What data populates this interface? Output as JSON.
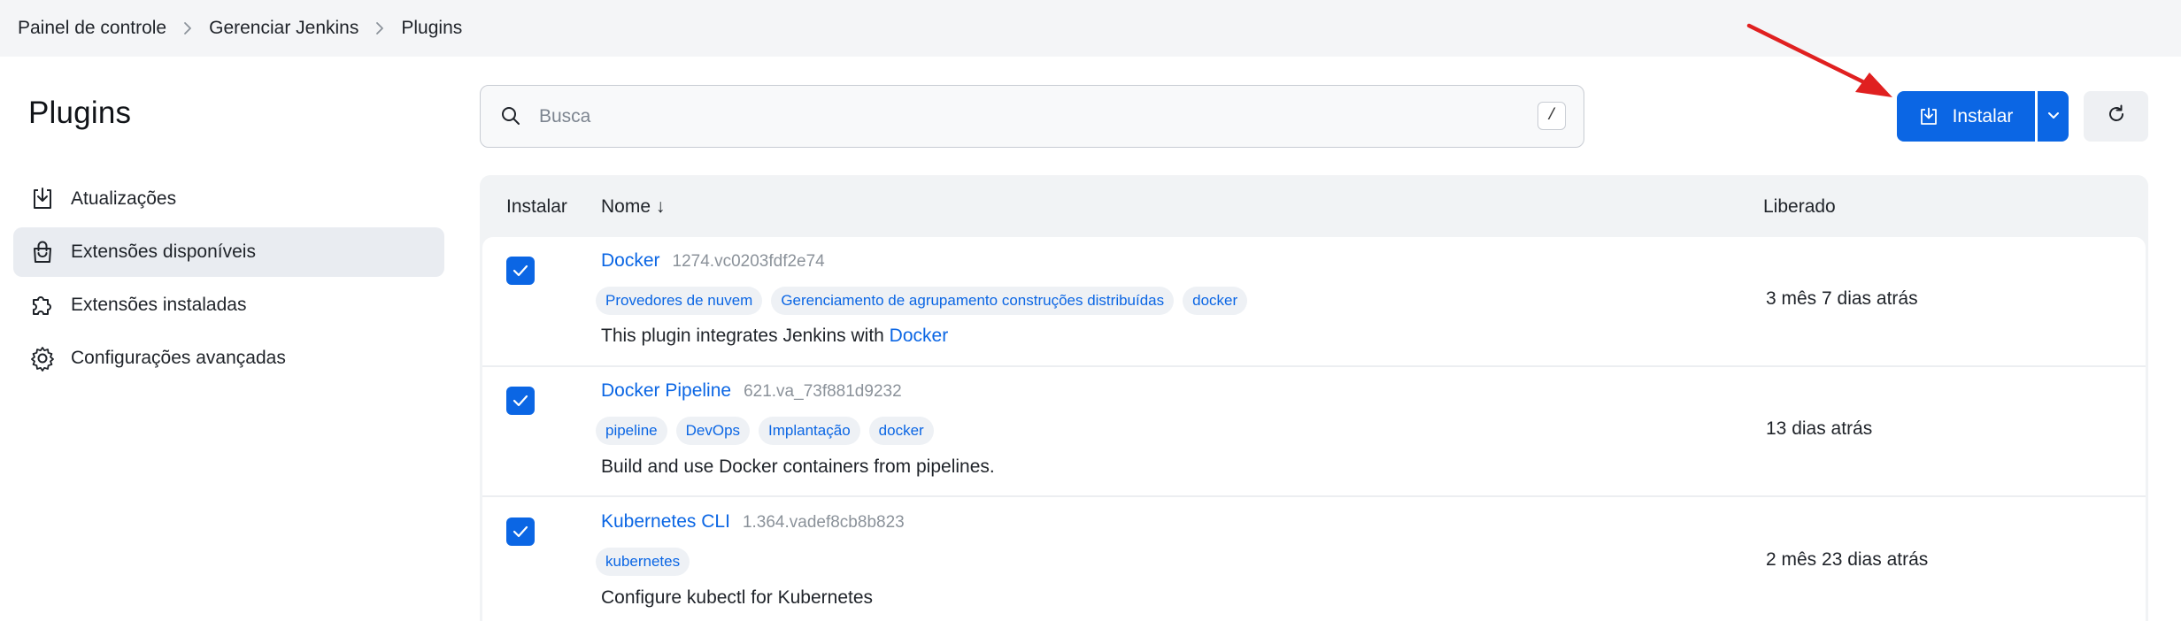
{
  "breadcrumb": {
    "items": [
      "Painel de controle",
      "Gerenciar Jenkins",
      "Plugins"
    ]
  },
  "page": {
    "title": "Plugins"
  },
  "sidebar": {
    "items": [
      {
        "label": "Atualizações",
        "icon": "download-tray-icon",
        "active": false
      },
      {
        "label": "Extensões disponíveis",
        "icon": "shopping-bag-icon",
        "active": true
      },
      {
        "label": "Extensões instaladas",
        "icon": "puzzle-piece-icon",
        "active": false
      },
      {
        "label": "Configurações avançadas",
        "icon": "gear-icon",
        "active": false
      }
    ]
  },
  "search": {
    "placeholder": "Busca",
    "value": "",
    "shortcut": "/"
  },
  "toolbar": {
    "install_label": "Instalar"
  },
  "table": {
    "headers": {
      "install": "Instalar",
      "name": "Nome ↓",
      "released": "Liberado"
    },
    "rows": [
      {
        "checked": true,
        "name": "Docker",
        "version": "1274.vc0203fdf2e74",
        "tags": [
          "Provedores de nuvem",
          "Gerenciamento de agrupamento construções distribuídas",
          "docker"
        ],
        "description": "This plugin integrates Jenkins with ",
        "description_link": "Docker",
        "released": "3 mês 7 dias atrás"
      },
      {
        "checked": true,
        "name": "Docker Pipeline",
        "version": "621.va_73f881d9232",
        "tags": [
          "pipeline",
          "DevOps",
          "Implantação",
          "docker"
        ],
        "description": "Build and use Docker containers from pipelines.",
        "released": "13 dias atrás"
      },
      {
        "checked": true,
        "name": "Kubernetes CLI",
        "version": "1.364.vadef8cb8b823",
        "tags": [
          "kubernetes"
        ],
        "description": "Configure kubectl for Kubernetes",
        "released": "2 mês 23 dias atrás"
      }
    ]
  },
  "colors": {
    "accent": "#0b66e4",
    "annotation_arrow": "#e02020"
  }
}
